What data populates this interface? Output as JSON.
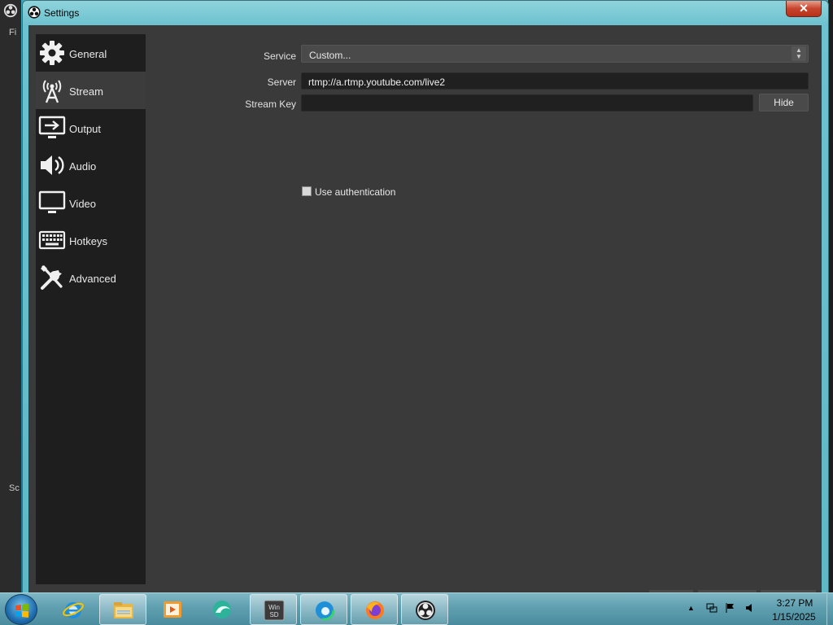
{
  "window": {
    "title": "Settings",
    "close_label": "✕"
  },
  "sidebar": {
    "items": [
      {
        "label": "General",
        "icon": "gear-icon"
      },
      {
        "label": "Stream",
        "icon": "broadcast-tower-icon",
        "active": true
      },
      {
        "label": "Output",
        "icon": "output-monitor-icon"
      },
      {
        "label": "Audio",
        "icon": "speaker-icon"
      },
      {
        "label": "Video",
        "icon": "monitor-icon"
      },
      {
        "label": "Hotkeys",
        "icon": "keyboard-icon"
      },
      {
        "label": "Advanced",
        "icon": "tools-icon"
      }
    ]
  },
  "stream": {
    "service_label": "Service",
    "service_value": "Custom...",
    "server_label": "Server",
    "server_value": "rtmp://a.rtmp.youtube.com/live2",
    "stream_key_label": "Stream Key",
    "stream_key_value": "",
    "hide_label": "Hide",
    "use_auth_label": "Use authentication",
    "use_auth_checked": false
  },
  "background": {
    "frag1": "Fi",
    "frag2": "Sc"
  },
  "taskbar": {
    "items": [
      {
        "name": "internet-explorer-icon",
        "state": "pinned"
      },
      {
        "name": "file-explorer-icon",
        "state": "open"
      },
      {
        "name": "media-player-icon",
        "state": "pinned"
      },
      {
        "name": "browser-swirl-icon",
        "state": "pinned"
      },
      {
        "name": "winsd-icon",
        "state": "open"
      },
      {
        "name": "edge-icon",
        "state": "open"
      },
      {
        "name": "firefox-icon",
        "state": "open"
      },
      {
        "name": "obs-icon",
        "state": "open"
      }
    ],
    "clock_time": "3:27 PM",
    "clock_date": "1/15/2025"
  },
  "colors": {
    "sidebar_bg": "#1e1e1e",
    "content_bg": "#3a3a3a",
    "accent": "#3c3c3c"
  }
}
